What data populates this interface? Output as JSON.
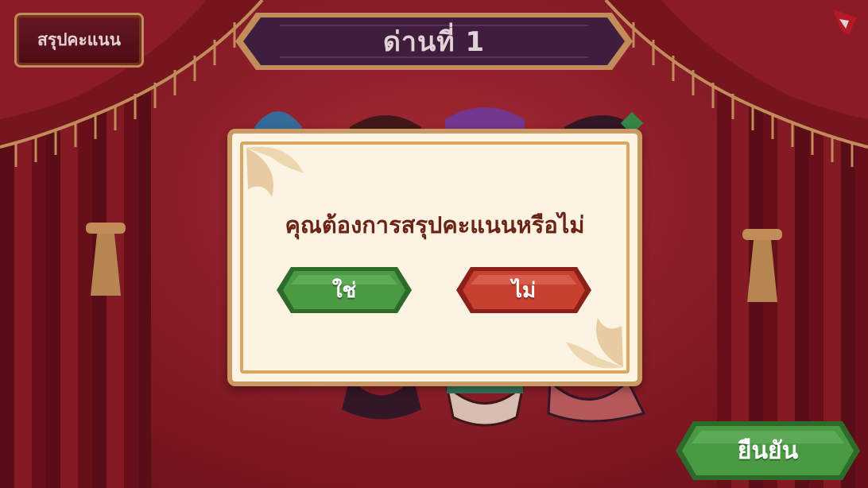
{
  "game": {
    "title": "ด่านที่ 1",
    "summary_button": "สรุปคะแนน",
    "confirm_button": "ยืนยัน"
  },
  "dialog": {
    "message": "คุณต้องการสรุปคะแนนหรือไม่",
    "yes_label": "ใช่",
    "no_label": "ไม่"
  },
  "colors": {
    "stage_red": "#a52a35",
    "curtain_dark": "#5a0e16",
    "gold_trim": "#d9a96a",
    "banner_purple": "#3a2346",
    "dialog_bg": "#fdf3e3",
    "message_text": "#6b2316",
    "yes_green": "#3f8b3c",
    "no_red": "#c2382b",
    "confirm_green": "#3f8b3c"
  },
  "icons": [
    "logo-icon",
    "mask-icon",
    "tassel-icon"
  ]
}
